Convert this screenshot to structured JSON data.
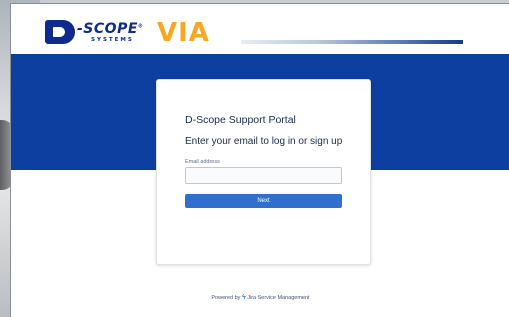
{
  "branding": {
    "logo_letter": "D",
    "logo_word": "-SCOPE",
    "logo_reg": "®",
    "logo_sub": "SYSTEMS",
    "logo_product": "VIA"
  },
  "login": {
    "portal_title": "D-Scope Support Portal",
    "heading": "Enter your email to log in or sign up",
    "email_label": "Email address",
    "email_value": "",
    "email_placeholder": "",
    "next_label": "Next"
  },
  "footer": {
    "powered_by": "Powered by",
    "product": "Jira Service Management",
    "icon": "jira-lightning-icon"
  },
  "colors": {
    "band_blue": "#0d3fa0",
    "brand_navy": "#0d2a8c",
    "brand_orange": "#f7a823",
    "button_blue": "#2e6fd0"
  }
}
